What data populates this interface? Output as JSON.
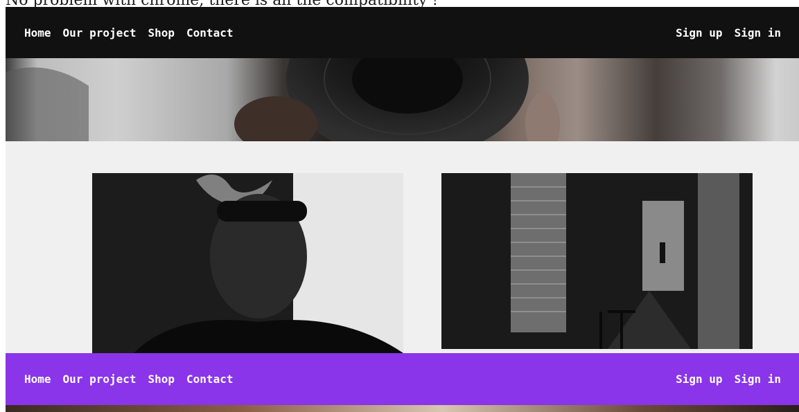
{
  "caption": "No problem with chrome, there is all the compatibility !",
  "header_dark": {
    "links": [
      "Home",
      "Our project",
      "Shop",
      "Contact"
    ],
    "auth": [
      "Sign up",
      "Sign in"
    ],
    "background": "#111111"
  },
  "header_purple": {
    "links": [
      "Home",
      "Our project",
      "Shop",
      "Contact"
    ],
    "auth": [
      "Sign up",
      "Sign in"
    ],
    "background": "#8a35ea"
  },
  "colors": {
    "page_background": "#f0f0f0",
    "nav_text": "#ffffff"
  }
}
